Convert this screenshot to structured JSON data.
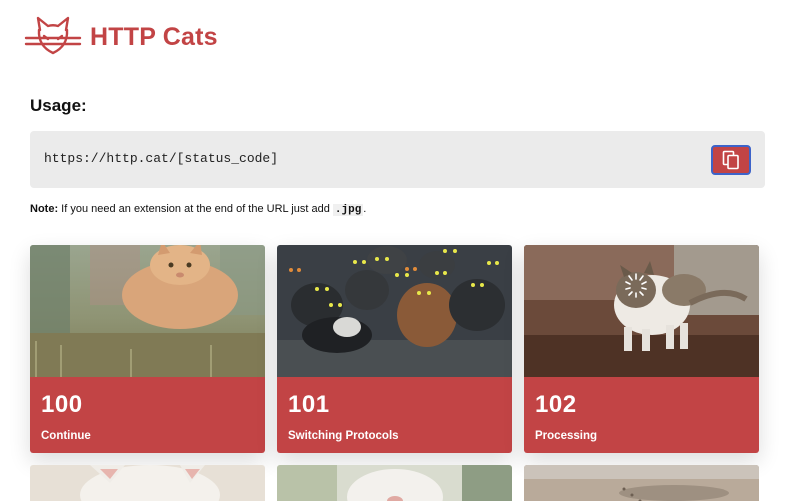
{
  "colors": {
    "brand": "#c24445",
    "copy_border": "#3d63c9"
  },
  "header": {
    "logo_icon": "cat-logo-icon",
    "brand": "HTTP Cats"
  },
  "usage": {
    "title": "Usage:",
    "url": "https://http.cat/[status_code]",
    "copy_icon": "copy-icon"
  },
  "note": {
    "label": "Note:",
    "text": " If you need an extension at the end of the URL just add ",
    "ext": ".jpg",
    "end": "."
  },
  "cards": [
    {
      "code": "100",
      "label": "Continue"
    },
    {
      "code": "101",
      "label": "Switching Protocols"
    },
    {
      "code": "102",
      "label": "Processing"
    }
  ]
}
